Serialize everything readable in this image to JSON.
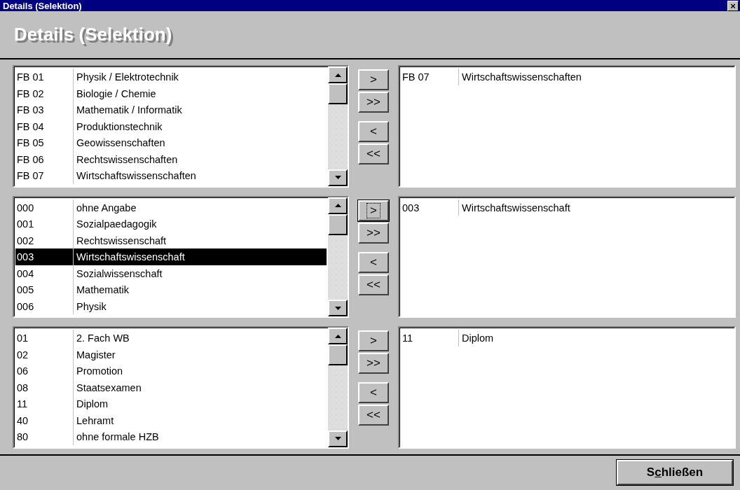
{
  "window": {
    "title": "Details (Selektion)",
    "close": "×"
  },
  "header": {
    "title": "Details (Selektion)"
  },
  "groups": [
    {
      "available": [
        {
          "code": "FB 01",
          "name": "Physik / Elektrotechnik",
          "selected": false
        },
        {
          "code": "FB 02",
          "name": "Biologie / Chemie",
          "selected": false
        },
        {
          "code": "FB 03",
          "name": "Mathematik / Informatik",
          "selected": false
        },
        {
          "code": "FB 04",
          "name": "Produktionstechnik",
          "selected": false
        },
        {
          "code": "FB 05",
          "name": "Geowissenschaften",
          "selected": false
        },
        {
          "code": "FB 06",
          "name": "Rechtswissenschaften",
          "selected": false
        },
        {
          "code": "FB 07",
          "name": "Wirtschaftswissenschaften",
          "selected": false
        }
      ],
      "buttons": [
        {
          "label": ">",
          "focused": false
        },
        {
          "label": ">>",
          "focused": false
        },
        {
          "label": "<",
          "focused": false
        },
        {
          "label": "<<",
          "focused": false
        }
      ],
      "chosen": [
        {
          "code": "FB 07",
          "name": "Wirtschaftswissenschaften"
        }
      ]
    },
    {
      "available": [
        {
          "code": "000",
          "name": "ohne Angabe",
          "selected": false
        },
        {
          "code": "001",
          "name": "Sozialpaedagogik",
          "selected": false
        },
        {
          "code": "002",
          "name": "Rechtswissenschaft",
          "selected": false
        },
        {
          "code": "003",
          "name": "Wirtschaftswissenschaft",
          "selected": true
        },
        {
          "code": "004",
          "name": "Sozialwissenschaft",
          "selected": false
        },
        {
          "code": "005",
          "name": "Mathematik",
          "selected": false
        },
        {
          "code": "006",
          "name": "Physik",
          "selected": false
        }
      ],
      "buttons": [
        {
          "label": ">",
          "focused": true
        },
        {
          "label": ">>",
          "focused": false
        },
        {
          "label": "<",
          "focused": false
        },
        {
          "label": "<<",
          "focused": false
        }
      ],
      "chosen": [
        {
          "code": "003",
          "name": "Wirtschaftswissenschaft"
        }
      ]
    },
    {
      "available": [
        {
          "code": "01",
          "name": "2. Fach WB",
          "selected": false
        },
        {
          "code": "02",
          "name": "Magister",
          "selected": false
        },
        {
          "code": "06",
          "name": "Promotion",
          "selected": false
        },
        {
          "code": "08",
          "name": "Staatsexamen",
          "selected": false
        },
        {
          "code": "11",
          "name": "Diplom",
          "selected": false
        },
        {
          "code": "40",
          "name": "Lehramt",
          "selected": false
        },
        {
          "code": "80",
          "name": "ohne formale HZB",
          "selected": false
        }
      ],
      "buttons": [
        {
          "label": ">",
          "focused": false
        },
        {
          "label": ">>",
          "focused": false
        },
        {
          "label": "<",
          "focused": false
        },
        {
          "label": "<<",
          "focused": false
        }
      ],
      "chosen": [
        {
          "code": "11",
          "name": "Diplom"
        }
      ]
    }
  ],
  "footer": {
    "close_button": {
      "label_before": "S",
      "accelerator": "c",
      "label_after": "hließen"
    }
  }
}
